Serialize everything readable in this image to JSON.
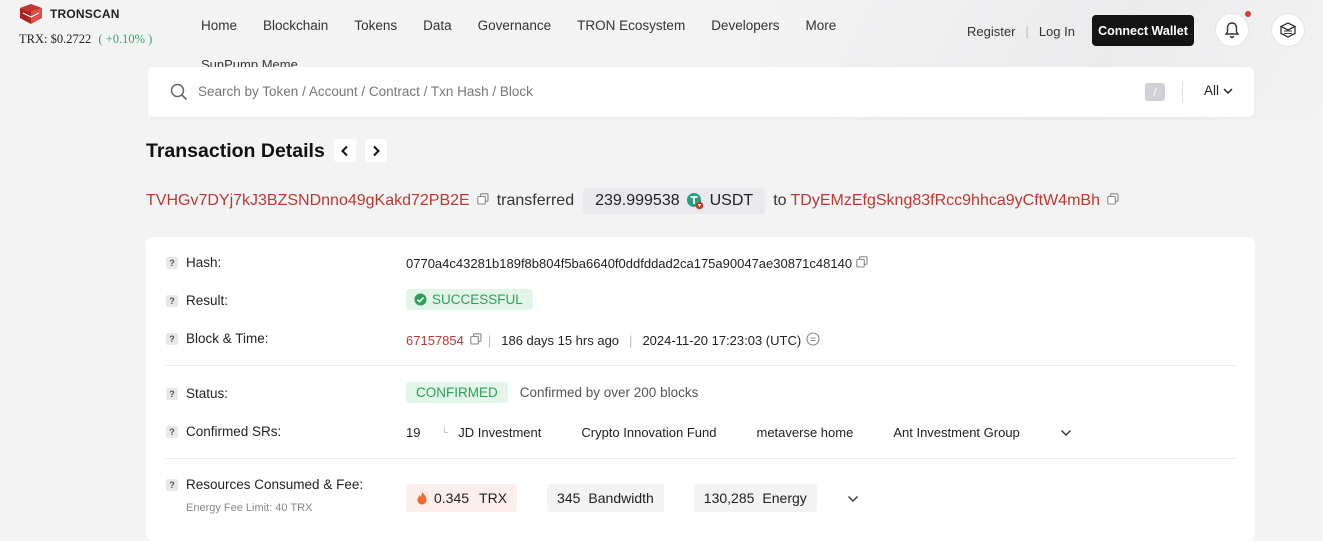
{
  "header": {
    "brand": "TRONSCAN",
    "price_label": "TRX: $0.2722",
    "price_change": "( +0.10% )",
    "nav": [
      "Home",
      "Blockchain",
      "Tokens",
      "Data",
      "Governance",
      "TRON Ecosystem",
      "Developers",
      "More"
    ],
    "nav_second_line": "SunPump Meme",
    "register": "Register",
    "login": "Log In",
    "connect_wallet": "Connect Wallet"
  },
  "search": {
    "placeholder": "Search by Token / Account / Contract / Txn Hash / Block",
    "shortcut": "/",
    "filter": "All"
  },
  "page": {
    "title": "Transaction Details"
  },
  "transfer": {
    "from": "TVHGv7DYj7kJ3BZSNDnno49gKakd72PB2E",
    "verb": "transferred",
    "amount": "239.999538",
    "token": "USDT",
    "to_word": "to",
    "to": "TDyEMzEfgSkng83fRcc9hhca9yCftW4mBh"
  },
  "details": {
    "hash_label": "Hash:",
    "hash": "0770a4c43281b189f8b804f5ba6640f0ddfddad2ca175a90047ae30871c48140",
    "result_label": "Result:",
    "result": "SUCCESSFUL",
    "block_label": "Block & Time:",
    "block": "67157854",
    "age": "186 days 15 hrs ago",
    "timestamp": "2024-11-20 17:23:03 (UTC)",
    "status_label": "Status:",
    "status": "CONFIRMED",
    "status_note": "Confirmed by over 200 blocks",
    "srs_label": "Confirmed SRs:",
    "srs_count": "19",
    "srs": [
      "JD Investment",
      "Crypto Innovation Fund",
      "metaverse home",
      "Ant Investment Group"
    ],
    "resources_label": "Resources Consumed & Fee:",
    "energy_fee_limit": "Energy Fee Limit: 40 TRX",
    "fee_value": "0.345",
    "fee_unit": "TRX",
    "bandwidth_value": "345",
    "bandwidth_unit": "Bandwidth",
    "energy_value": "130,285",
    "energy_unit": "Energy"
  },
  "colors": {
    "link_red": "#c23631",
    "success_green": "#2aa156",
    "button_dark": "#141414"
  }
}
